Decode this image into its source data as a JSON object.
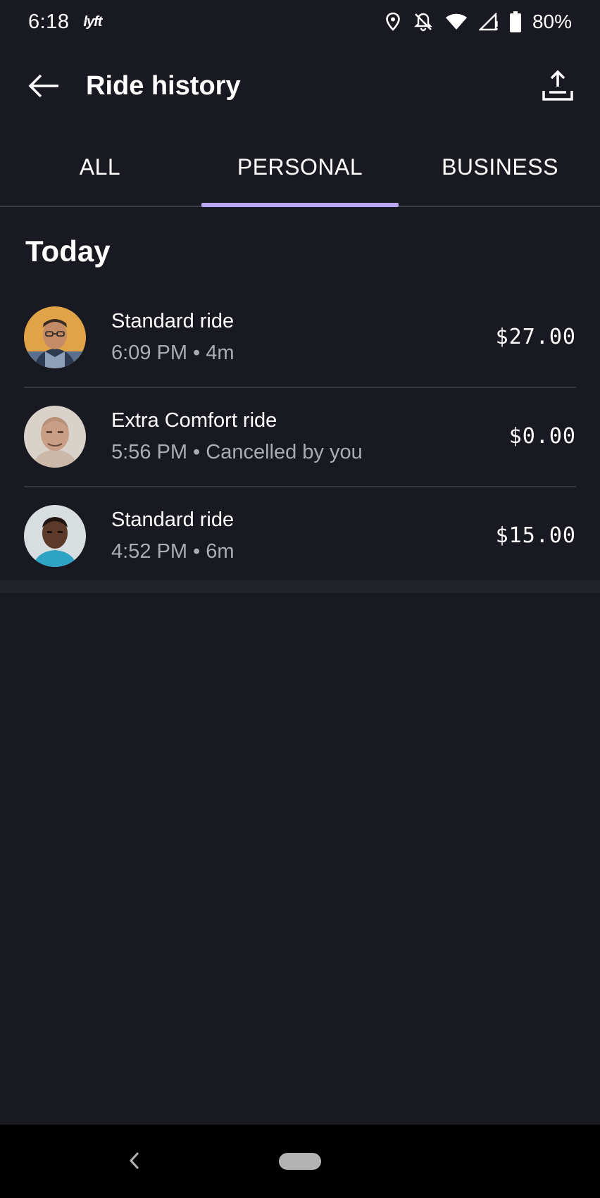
{
  "status_bar": {
    "time": "6:18",
    "app_badge": "lyft",
    "battery": "80%",
    "icons": [
      "location-icon",
      "notifications-off-icon",
      "wifi-icon",
      "signal-icon",
      "battery-icon"
    ]
  },
  "header": {
    "title": "Ride history",
    "back_icon": "back-arrow-icon",
    "export_icon": "export-icon"
  },
  "tabs": [
    {
      "label": "ALL",
      "active": false
    },
    {
      "label": "PERSONAL",
      "active": true
    },
    {
      "label": "BUSINESS",
      "active": false
    }
  ],
  "accent_color": "#b8a6f5",
  "section": {
    "title": "Today"
  },
  "rides": [
    {
      "type": "Standard ride",
      "meta": "6:09 PM • 4m",
      "price": "$27.00",
      "avatar": "driver-avatar"
    },
    {
      "type": "Extra Comfort ride",
      "meta": "5:56 PM • Cancelled by you",
      "price": "$0.00",
      "avatar": "driver-avatar"
    },
    {
      "type": "Standard ride",
      "meta": "4:52 PM • 6m",
      "price": "$15.00",
      "avatar": "driver-avatar"
    }
  ],
  "nav_bar": {
    "back_icon": "nav-back-icon",
    "home_icon": "home-pill-icon"
  }
}
